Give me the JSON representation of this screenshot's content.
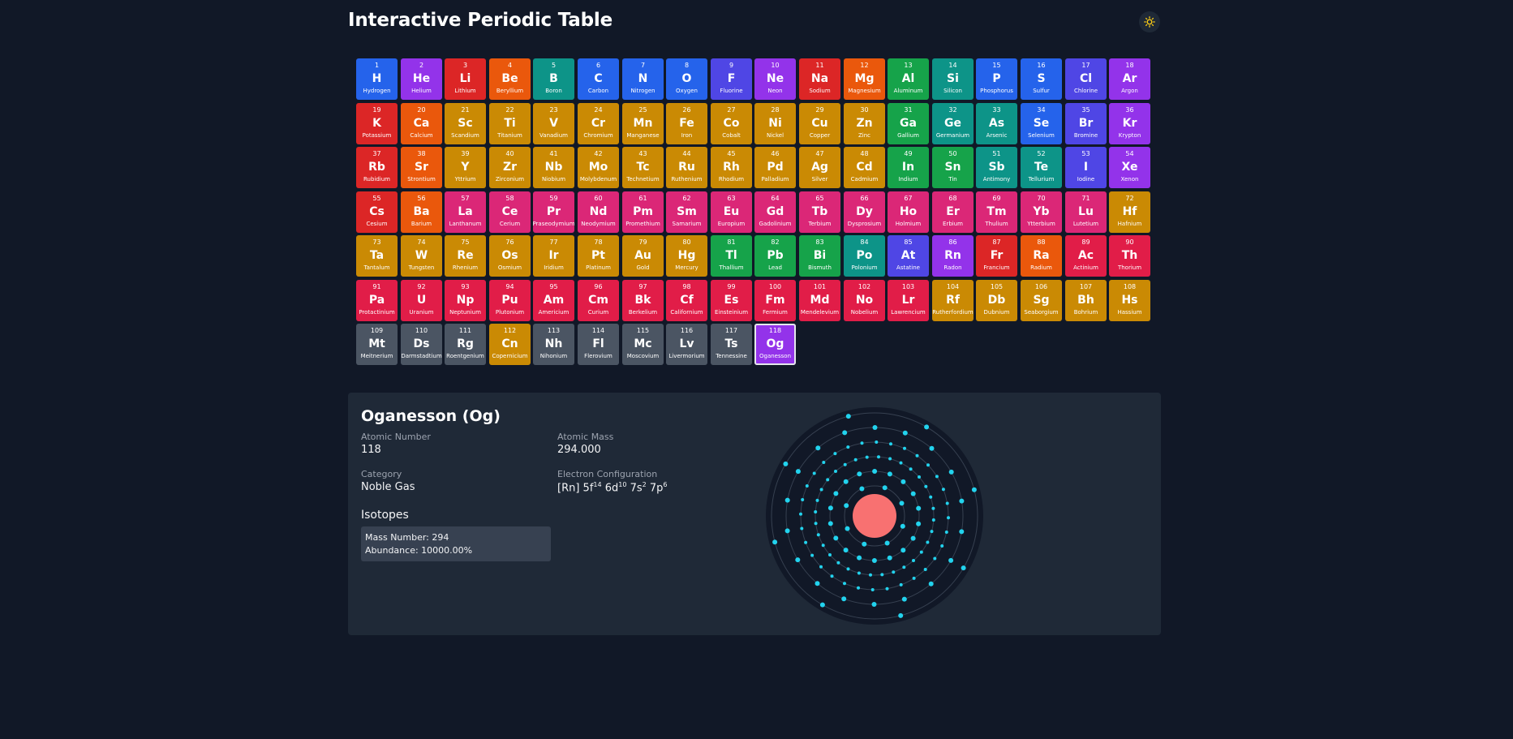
{
  "header": {
    "title": "Interactive Periodic Table",
    "theme_toggle_icon": "sun-icon"
  },
  "categories": {
    "nonmetal": "#2563eb",
    "noble": "#9333ea",
    "alkali": "#dc2626",
    "alkaline": "#ea580c",
    "transition": "#ca8a04",
    "metalloid": "#0d9488",
    "poor": "#16a34a",
    "halogen": "#4f46e5",
    "lanthanide": "#db2777",
    "actinide": "#e11d48",
    "unknown": "#4b5563"
  },
  "elements": [
    {
      "n": 1,
      "s": "H",
      "name": "Hydrogen",
      "c": "nonmetal"
    },
    {
      "n": 2,
      "s": "He",
      "name": "Helium",
      "c": "noble"
    },
    {
      "n": 3,
      "s": "Li",
      "name": "Lithium",
      "c": "alkali"
    },
    {
      "n": 4,
      "s": "Be",
      "name": "Beryllium",
      "c": "alkaline"
    },
    {
      "n": 5,
      "s": "B",
      "name": "Boron",
      "c": "metalloid"
    },
    {
      "n": 6,
      "s": "C",
      "name": "Carbon",
      "c": "nonmetal"
    },
    {
      "n": 7,
      "s": "N",
      "name": "Nitrogen",
      "c": "nonmetal"
    },
    {
      "n": 8,
      "s": "O",
      "name": "Oxygen",
      "c": "nonmetal"
    },
    {
      "n": 9,
      "s": "F",
      "name": "Fluorine",
      "c": "halogen"
    },
    {
      "n": 10,
      "s": "Ne",
      "name": "Neon",
      "c": "noble"
    },
    {
      "n": 11,
      "s": "Na",
      "name": "Sodium",
      "c": "alkali"
    },
    {
      "n": 12,
      "s": "Mg",
      "name": "Magnesium",
      "c": "alkaline"
    },
    {
      "n": 13,
      "s": "Al",
      "name": "Aluminum",
      "c": "poor"
    },
    {
      "n": 14,
      "s": "Si",
      "name": "Silicon",
      "c": "metalloid"
    },
    {
      "n": 15,
      "s": "P",
      "name": "Phosphorus",
      "c": "nonmetal"
    },
    {
      "n": 16,
      "s": "S",
      "name": "Sulfur",
      "c": "nonmetal"
    },
    {
      "n": 17,
      "s": "Cl",
      "name": "Chlorine",
      "c": "halogen"
    },
    {
      "n": 18,
      "s": "Ar",
      "name": "Argon",
      "c": "noble"
    },
    {
      "n": 19,
      "s": "K",
      "name": "Potassium",
      "c": "alkali"
    },
    {
      "n": 20,
      "s": "Ca",
      "name": "Calcium",
      "c": "alkaline"
    },
    {
      "n": 21,
      "s": "Sc",
      "name": "Scandium",
      "c": "transition"
    },
    {
      "n": 22,
      "s": "Ti",
      "name": "Titanium",
      "c": "transition"
    },
    {
      "n": 23,
      "s": "V",
      "name": "Vanadium",
      "c": "transition"
    },
    {
      "n": 24,
      "s": "Cr",
      "name": "Chromium",
      "c": "transition"
    },
    {
      "n": 25,
      "s": "Mn",
      "name": "Manganese",
      "c": "transition"
    },
    {
      "n": 26,
      "s": "Fe",
      "name": "Iron",
      "c": "transition"
    },
    {
      "n": 27,
      "s": "Co",
      "name": "Cobalt",
      "c": "transition"
    },
    {
      "n": 28,
      "s": "Ni",
      "name": "Nickel",
      "c": "transition"
    },
    {
      "n": 29,
      "s": "Cu",
      "name": "Copper",
      "c": "transition"
    },
    {
      "n": 30,
      "s": "Zn",
      "name": "Zinc",
      "c": "transition"
    },
    {
      "n": 31,
      "s": "Ga",
      "name": "Gallium",
      "c": "poor"
    },
    {
      "n": 32,
      "s": "Ge",
      "name": "Germanium",
      "c": "metalloid"
    },
    {
      "n": 33,
      "s": "As",
      "name": "Arsenic",
      "c": "metalloid"
    },
    {
      "n": 34,
      "s": "Se",
      "name": "Selenium",
      "c": "nonmetal"
    },
    {
      "n": 35,
      "s": "Br",
      "name": "Bromine",
      "c": "halogen"
    },
    {
      "n": 36,
      "s": "Kr",
      "name": "Krypton",
      "c": "noble"
    },
    {
      "n": 37,
      "s": "Rb",
      "name": "Rubidium",
      "c": "alkali"
    },
    {
      "n": 38,
      "s": "Sr",
      "name": "Strontium",
      "c": "alkaline"
    },
    {
      "n": 39,
      "s": "Y",
      "name": "Yttrium",
      "c": "transition"
    },
    {
      "n": 40,
      "s": "Zr",
      "name": "Zirconium",
      "c": "transition"
    },
    {
      "n": 41,
      "s": "Nb",
      "name": "Niobium",
      "c": "transition"
    },
    {
      "n": 42,
      "s": "Mo",
      "name": "Molybdenum",
      "c": "transition"
    },
    {
      "n": 43,
      "s": "Tc",
      "name": "Technetium",
      "c": "transition"
    },
    {
      "n": 44,
      "s": "Ru",
      "name": "Ruthenium",
      "c": "transition"
    },
    {
      "n": 45,
      "s": "Rh",
      "name": "Rhodium",
      "c": "transition"
    },
    {
      "n": 46,
      "s": "Pd",
      "name": "Palladium",
      "c": "transition"
    },
    {
      "n": 47,
      "s": "Ag",
      "name": "Silver",
      "c": "transition"
    },
    {
      "n": 48,
      "s": "Cd",
      "name": "Cadmium",
      "c": "transition"
    },
    {
      "n": 49,
      "s": "In",
      "name": "Indium",
      "c": "poor"
    },
    {
      "n": 50,
      "s": "Sn",
      "name": "Tin",
      "c": "poor"
    },
    {
      "n": 51,
      "s": "Sb",
      "name": "Antimony",
      "c": "metalloid"
    },
    {
      "n": 52,
      "s": "Te",
      "name": "Tellurium",
      "c": "metalloid"
    },
    {
      "n": 53,
      "s": "I",
      "name": "Iodine",
      "c": "halogen"
    },
    {
      "n": 54,
      "s": "Xe",
      "name": "Xenon",
      "c": "noble"
    },
    {
      "n": 55,
      "s": "Cs",
      "name": "Cesium",
      "c": "alkali"
    },
    {
      "n": 56,
      "s": "Ba",
      "name": "Barium",
      "c": "alkaline"
    },
    {
      "n": 57,
      "s": "La",
      "name": "Lanthanum",
      "c": "lanthanide"
    },
    {
      "n": 58,
      "s": "Ce",
      "name": "Cerium",
      "c": "lanthanide"
    },
    {
      "n": 59,
      "s": "Pr",
      "name": "Praseodymium",
      "c": "lanthanide"
    },
    {
      "n": 60,
      "s": "Nd",
      "name": "Neodymium",
      "c": "lanthanide"
    },
    {
      "n": 61,
      "s": "Pm",
      "name": "Promethium",
      "c": "lanthanide"
    },
    {
      "n": 62,
      "s": "Sm",
      "name": "Samarium",
      "c": "lanthanide"
    },
    {
      "n": 63,
      "s": "Eu",
      "name": "Europium",
      "c": "lanthanide"
    },
    {
      "n": 64,
      "s": "Gd",
      "name": "Gadolinium",
      "c": "lanthanide"
    },
    {
      "n": 65,
      "s": "Tb",
      "name": "Terbium",
      "c": "lanthanide"
    },
    {
      "n": 66,
      "s": "Dy",
      "name": "Dysprosium",
      "c": "lanthanide"
    },
    {
      "n": 67,
      "s": "Ho",
      "name": "Holmium",
      "c": "lanthanide"
    },
    {
      "n": 68,
      "s": "Er",
      "name": "Erbium",
      "c": "lanthanide"
    },
    {
      "n": 69,
      "s": "Tm",
      "name": "Thulium",
      "c": "lanthanide"
    },
    {
      "n": 70,
      "s": "Yb",
      "name": "Ytterbium",
      "c": "lanthanide"
    },
    {
      "n": 71,
      "s": "Lu",
      "name": "Lutetium",
      "c": "lanthanide"
    },
    {
      "n": 72,
      "s": "Hf",
      "name": "Hafnium",
      "c": "transition"
    },
    {
      "n": 73,
      "s": "Ta",
      "name": "Tantalum",
      "c": "transition"
    },
    {
      "n": 74,
      "s": "W",
      "name": "Tungsten",
      "c": "transition"
    },
    {
      "n": 75,
      "s": "Re",
      "name": "Rhenium",
      "c": "transition"
    },
    {
      "n": 76,
      "s": "Os",
      "name": "Osmium",
      "c": "transition"
    },
    {
      "n": 77,
      "s": "Ir",
      "name": "Iridium",
      "c": "transition"
    },
    {
      "n": 78,
      "s": "Pt",
      "name": "Platinum",
      "c": "transition"
    },
    {
      "n": 79,
      "s": "Au",
      "name": "Gold",
      "c": "transition"
    },
    {
      "n": 80,
      "s": "Hg",
      "name": "Mercury",
      "c": "transition"
    },
    {
      "n": 81,
      "s": "Tl",
      "name": "Thallium",
      "c": "poor"
    },
    {
      "n": 82,
      "s": "Pb",
      "name": "Lead",
      "c": "poor"
    },
    {
      "n": 83,
      "s": "Bi",
      "name": "Bismuth",
      "c": "poor"
    },
    {
      "n": 84,
      "s": "Po",
      "name": "Polonium",
      "c": "metalloid"
    },
    {
      "n": 85,
      "s": "At",
      "name": "Astatine",
      "c": "halogen"
    },
    {
      "n": 86,
      "s": "Rn",
      "name": "Radon",
      "c": "noble"
    },
    {
      "n": 87,
      "s": "Fr",
      "name": "Francium",
      "c": "alkali"
    },
    {
      "n": 88,
      "s": "Ra",
      "name": "Radium",
      "c": "alkaline"
    },
    {
      "n": 89,
      "s": "Ac",
      "name": "Actinium",
      "c": "actinide"
    },
    {
      "n": 90,
      "s": "Th",
      "name": "Thorium",
      "c": "actinide"
    },
    {
      "n": 91,
      "s": "Pa",
      "name": "Protactinium",
      "c": "actinide"
    },
    {
      "n": 92,
      "s": "U",
      "name": "Uranium",
      "c": "actinide"
    },
    {
      "n": 93,
      "s": "Np",
      "name": "Neptunium",
      "c": "actinide"
    },
    {
      "n": 94,
      "s": "Pu",
      "name": "Plutonium",
      "c": "actinide"
    },
    {
      "n": 95,
      "s": "Am",
      "name": "Americium",
      "c": "actinide"
    },
    {
      "n": 96,
      "s": "Cm",
      "name": "Curium",
      "c": "actinide"
    },
    {
      "n": 97,
      "s": "Bk",
      "name": "Berkelium",
      "c": "actinide"
    },
    {
      "n": 98,
      "s": "Cf",
      "name": "Californium",
      "c": "actinide"
    },
    {
      "n": 99,
      "s": "Es",
      "name": "Einsteinium",
      "c": "actinide"
    },
    {
      "n": 100,
      "s": "Fm",
      "name": "Fermium",
      "c": "actinide"
    },
    {
      "n": 101,
      "s": "Md",
      "name": "Mendelevium",
      "c": "actinide"
    },
    {
      "n": 102,
      "s": "No",
      "name": "Nobelium",
      "c": "actinide"
    },
    {
      "n": 103,
      "s": "Lr",
      "name": "Lawrencium",
      "c": "actinide"
    },
    {
      "n": 104,
      "s": "Rf",
      "name": "Rutherfordium",
      "c": "transition"
    },
    {
      "n": 105,
      "s": "Db",
      "name": "Dubnium",
      "c": "transition"
    },
    {
      "n": 106,
      "s": "Sg",
      "name": "Seaborgium",
      "c": "transition"
    },
    {
      "n": 107,
      "s": "Bh",
      "name": "Bohrium",
      "c": "transition"
    },
    {
      "n": 108,
      "s": "Hs",
      "name": "Hassium",
      "c": "transition"
    },
    {
      "n": 109,
      "s": "Mt",
      "name": "Meitnerium",
      "c": "unknown"
    },
    {
      "n": 110,
      "s": "Ds",
      "name": "Darmstadtium",
      "c": "unknown"
    },
    {
      "n": 111,
      "s": "Rg",
      "name": "Roentgenium",
      "c": "unknown"
    },
    {
      "n": 112,
      "s": "Cn",
      "name": "Copernicium",
      "c": "transition"
    },
    {
      "n": 113,
      "s": "Nh",
      "name": "Nihonium",
      "c": "unknown"
    },
    {
      "n": 114,
      "s": "Fl",
      "name": "Flerovium",
      "c": "unknown"
    },
    {
      "n": 115,
      "s": "Mc",
      "name": "Moscovium",
      "c": "unknown"
    },
    {
      "n": 116,
      "s": "Lv",
      "name": "Livermorium",
      "c": "unknown"
    },
    {
      "n": 117,
      "s": "Ts",
      "name": "Tennessine",
      "c": "unknown"
    },
    {
      "n": 118,
      "s": "Og",
      "name": "Oganesson",
      "c": "noble"
    }
  ],
  "selected_number": 118,
  "details": {
    "title": "Oganesson (Og)",
    "atomic_number_label": "Atomic Number",
    "atomic_number": "118",
    "atomic_mass_label": "Atomic Mass",
    "atomic_mass": "294.000",
    "category_label": "Category",
    "category": "Noble Gas",
    "config_label": "Electron Configuration",
    "config": {
      "core": "[Rn]",
      "terms": [
        {
          "orbital": "5f",
          "sup": "14"
        },
        {
          "orbital": "6d",
          "sup": "10"
        },
        {
          "orbital": "7s",
          "sup": "2"
        },
        {
          "orbital": "7p",
          "sup": "6"
        }
      ]
    },
    "isotopes_label": "Isotopes",
    "isotopes": [
      {
        "mass_line": "Mass Number: 294",
        "abundance_line": "Abundance: 10000.00%"
      }
    ]
  },
  "atom_model": {
    "shells": [
      2,
      8,
      18,
      32,
      32,
      18,
      8
    ],
    "nucleus_color": "#f87171",
    "electron_color": "#22d3ee",
    "orbit_color": "#374151"
  }
}
